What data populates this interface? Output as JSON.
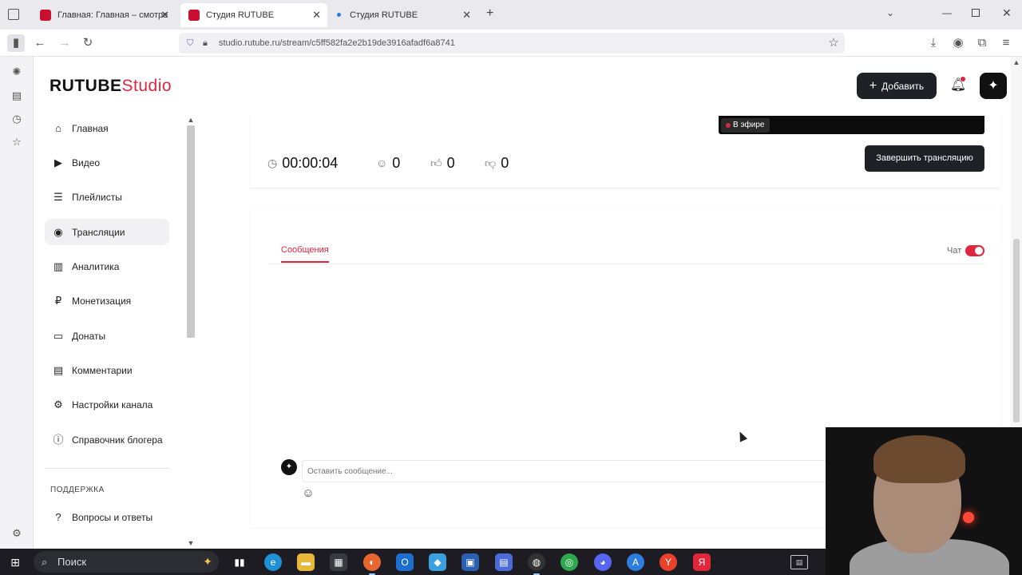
{
  "browser": {
    "tabs": [
      {
        "title": "Главная: Главная – смотреть о",
        "active": false
      },
      {
        "title": "Студия RUTUBE",
        "active": true
      },
      {
        "title": "Студия RUTUBE",
        "active": false
      }
    ],
    "new_tab": "+",
    "url": "studio.rutube.ru/stream/c5ff582fa2e2b19de3916afadf6a8741",
    "icons": {
      "back": "arrow-left-icon",
      "forward": "arrow-right-icon",
      "reload": "reload-icon",
      "bookmark": "star-icon",
      "download": "download-icon",
      "account": "account-icon",
      "extensions": "extensions-icon",
      "menu": "menu-icon"
    }
  },
  "app": {
    "logo_main": "RUTUBE",
    "logo_studio": "Studio",
    "add_button": "Добавить",
    "accent_color": "#e0253d"
  },
  "sidebar": {
    "items": [
      {
        "label": "Главная",
        "icon": "home-icon"
      },
      {
        "label": "Видео",
        "icon": "video-icon"
      },
      {
        "label": "Плейлисты",
        "icon": "playlist-icon"
      },
      {
        "label": "Трансляции",
        "icon": "broadcast-icon",
        "active": true
      },
      {
        "label": "Аналитика",
        "icon": "analytics-icon"
      },
      {
        "label": "Монетизация",
        "icon": "ruble-icon"
      },
      {
        "label": "Донаты",
        "icon": "wallet-icon"
      },
      {
        "label": "Комментарии",
        "icon": "comment-icon"
      },
      {
        "label": "Настройки канала",
        "icon": "gear-icon"
      },
      {
        "label": "Справочник блогера",
        "icon": "info-icon"
      }
    ],
    "support_heading": "ПОДДЕРЖКА",
    "support_items": [
      {
        "label": "Вопросы и ответы",
        "icon": "help-icon"
      }
    ]
  },
  "stream": {
    "live_badge": "В эфире",
    "duration": "00:00:04",
    "viewers": "0",
    "likes": "0",
    "dislikes": "0",
    "end_button": "Завершить трансляцию"
  },
  "chat": {
    "tab_messages": "Сообщения",
    "chat_label": "Чат",
    "chat_enabled": true,
    "input_placeholder": "Оставить сообщение..."
  },
  "taskbar": {
    "search_label": "Поиск"
  }
}
